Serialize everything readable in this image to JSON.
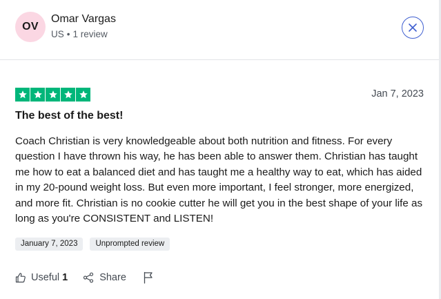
{
  "reviewer": {
    "initials": "OV",
    "name": "Omar Vargas",
    "country": "US",
    "separator": "•",
    "review_count": "1 review"
  },
  "review": {
    "rating": 5,
    "date": "Jan 7, 2023",
    "title": "The best of the best!",
    "body": "Coach Christian is very knowledgeable about both nutrition and fitness. For every question I have thrown his way, he has been able to answer them. Christian has taught me how to eat a balanced diet and has taught me a healthy way to eat, which has aided in my 20-pound weight loss. But even more important, I feel stronger, more energized, and more fit. Christian is no cookie cutter he will get you in the best shape of your life as long as you're CONSISTENT and LISTEN!",
    "tags": [
      "January 7, 2023",
      "Unprompted review"
    ]
  },
  "actions": {
    "useful_label": "Useful",
    "useful_count": "1",
    "share_label": "Share"
  },
  "icons": {
    "close": "close-icon",
    "star": "star-icon",
    "thumbs_up": "thumbs-up-icon",
    "share": "share-icon",
    "flag": "flag-icon"
  },
  "colors": {
    "star_green": "#00b67a",
    "avatar_pink": "#fbd7e3",
    "close_blue": "#3f5fd0",
    "tag_bg": "#eceef1"
  }
}
